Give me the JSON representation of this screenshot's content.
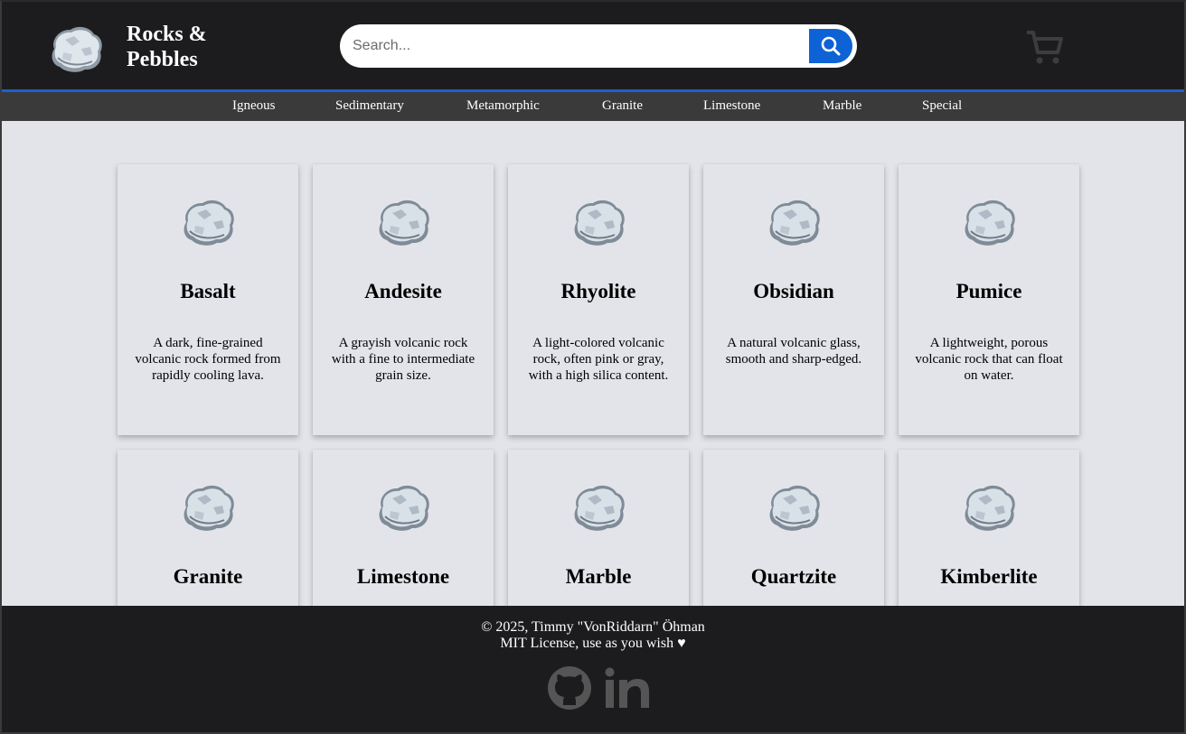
{
  "header": {
    "brand_line1": "Rocks &",
    "brand_line2": "Pebbles",
    "search_placeholder": "Search...",
    "accent_color": "#0d63d6"
  },
  "nav": {
    "items": [
      {
        "label": "Igneous"
      },
      {
        "label": "Sedimentary"
      },
      {
        "label": "Metamorphic"
      },
      {
        "label": "Granite"
      },
      {
        "label": "Limestone"
      },
      {
        "label": "Marble"
      },
      {
        "label": "Special"
      }
    ]
  },
  "cards": [
    {
      "title": "Basalt",
      "desc": "A dark, fine-grained volcanic rock formed from rapidly cooling lava."
    },
    {
      "title": "Andesite",
      "desc": "A grayish volcanic rock with a fine to intermediate grain size."
    },
    {
      "title": "Rhyolite",
      "desc": "A light-colored volcanic rock, often pink or gray, with a high silica content."
    },
    {
      "title": "Obsidian",
      "desc": "A natural volcanic glass, smooth and sharp-edged."
    },
    {
      "title": "Pumice",
      "desc": "A lightweight, porous volcanic rock that can float on water."
    },
    {
      "title": "Granite",
      "desc": ""
    },
    {
      "title": "Limestone",
      "desc": ""
    },
    {
      "title": "Marble",
      "desc": ""
    },
    {
      "title": "Quartzite",
      "desc": ""
    },
    {
      "title": "Kimberlite",
      "desc": ""
    }
  ],
  "footer": {
    "copyright": "© 2025, Timmy \"VonRiddarn\" Öhman",
    "license": "MIT License, use as you wish ♥",
    "icons": [
      "github-icon",
      "linkedin-icon"
    ]
  }
}
